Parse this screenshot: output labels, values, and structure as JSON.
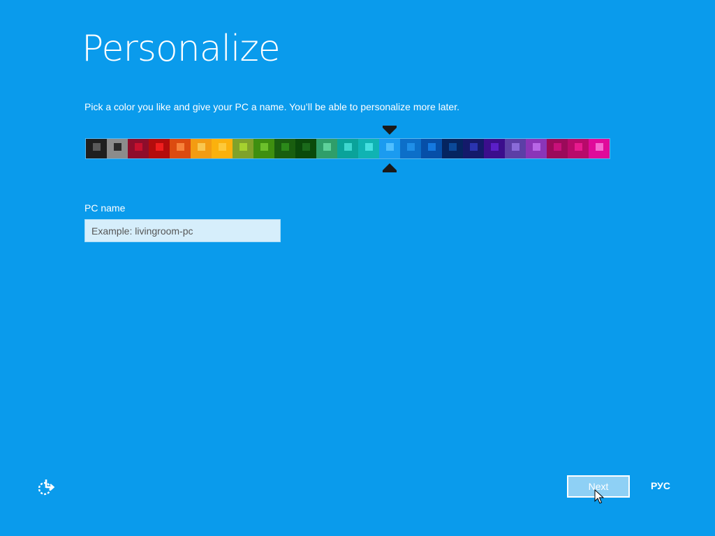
{
  "header": {
    "title": "Personalize",
    "subtitle": "Pick a color you like and give your PC a name. You’ll be able to personalize more later."
  },
  "color_picker": {
    "selected_index": 14,
    "swatches": [
      {
        "bg": "#1f1f1f",
        "chip": "#5a5a5a"
      },
      {
        "bg": "#8c8c8c",
        "chip": "#2a2a2a"
      },
      {
        "bg": "#8e0d2b",
        "chip": "#c8102e"
      },
      {
        "bg": "#b30c0c",
        "chip": "#f01e1e"
      },
      {
        "bg": "#dc4b10",
        "chip": "#f7823b"
      },
      {
        "bg": "#f39c12",
        "chip": "#f9c74f"
      },
      {
        "bg": "#fbb10d",
        "chip": "#fdc93a"
      },
      {
        "bg": "#7fa22a",
        "chip": "#a5d12f"
      },
      {
        "bg": "#3e8f10",
        "chip": "#6cc02c"
      },
      {
        "bg": "#195e0f",
        "chip": "#2c8a1a"
      },
      {
        "bg": "#0a4a0a",
        "chip": "#1a6a1a"
      },
      {
        "bg": "#2f9e6a",
        "chip": "#5ed19a"
      },
      {
        "bg": "#0aa39a",
        "chip": "#3dd6ce"
      },
      {
        "bg": "#10b3b3",
        "chip": "#45e0e0"
      },
      {
        "bg": "#1b9bf0",
        "chip": "#4fbfff"
      },
      {
        "bg": "#0c6fc9",
        "chip": "#1f8fe8"
      },
      {
        "bg": "#064fa8",
        "chip": "#1479e0"
      },
      {
        "bg": "#052560",
        "chip": "#0b4a9a"
      },
      {
        "bg": "#141a6a",
        "chip": "#2a34b0"
      },
      {
        "bg": "#3b0e8c",
        "chip": "#5b1fc8"
      },
      {
        "bg": "#5c3fa6",
        "chip": "#8a6bd8"
      },
      {
        "bg": "#8a35b8",
        "chip": "#b866e6"
      },
      {
        "bg": "#9b0a5a",
        "chip": "#c8107a"
      },
      {
        "bg": "#b80a6a",
        "chip": "#e81a8e"
      },
      {
        "bg": "#e00a9a",
        "chip": "#f56ad0"
      }
    ]
  },
  "pc_name": {
    "label": "PC name",
    "value": "",
    "placeholder": "Example: livingroom-pc"
  },
  "footer": {
    "ease_of_access_icon": "ease-of-access-icon",
    "next_label": "Next",
    "language_label": "РУС"
  },
  "colors": {
    "background": "#0a9bec",
    "button_bg": "#8ed0f5",
    "input_bg": "#d6eefb"
  }
}
